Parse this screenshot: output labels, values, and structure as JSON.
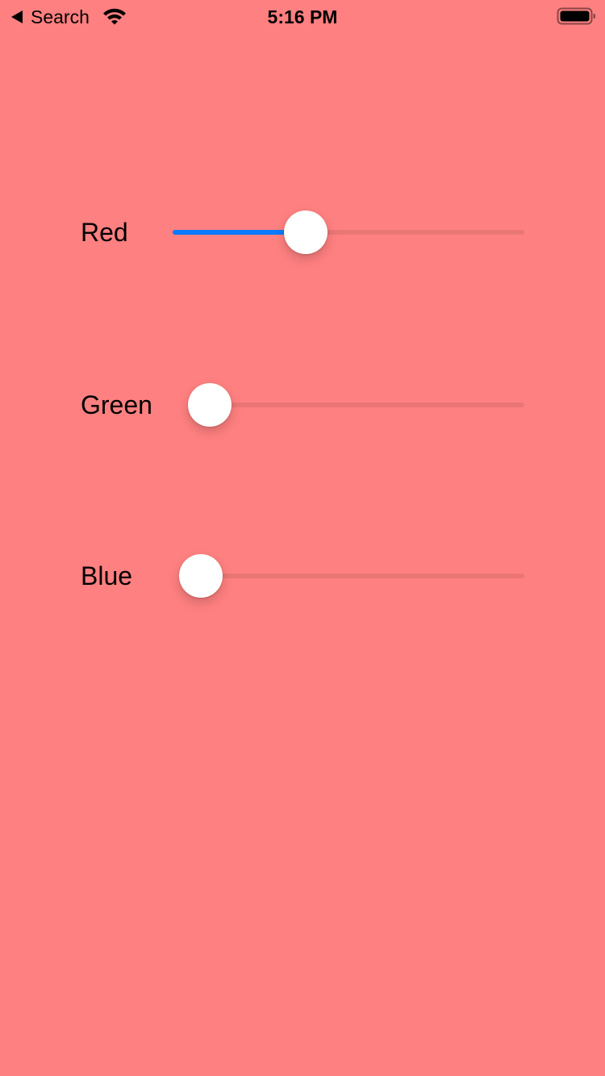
{
  "colors": {
    "background": "#ff8080",
    "accent": "#0a7aff"
  },
  "status_bar": {
    "back_label": "Search",
    "back_icon": "chevron-left-icon",
    "wifi_icon": "wifi-icon",
    "time": "5:16 PM",
    "battery_icon": "battery-icon"
  },
  "sliders": [
    {
      "label": "Red",
      "value": 0.36
    },
    {
      "label": "Green",
      "value": 0.0
    },
    {
      "label": "Blue",
      "value": 0.0
    }
  ]
}
